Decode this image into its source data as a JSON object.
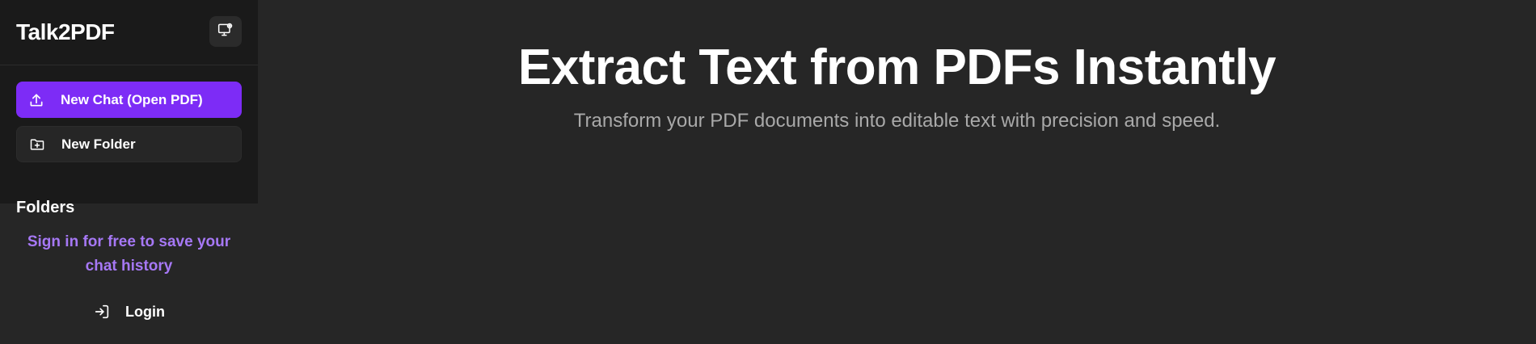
{
  "sidebar": {
    "brand": "Talk2PDF",
    "settings_icon": "monitor-settings-icon",
    "new_chat_label": "New Chat (Open PDF)",
    "new_chat_icon": "upload-icon",
    "new_folder_label": "New Folder",
    "new_folder_icon": "folder-plus-icon",
    "folders_heading": "Folders",
    "signin_prompt": "Sign in for free to save your chat history",
    "login_label": "Login",
    "login_icon": "login-icon"
  },
  "main": {
    "title": "Extract Text from PDFs Instantly",
    "subtitle": "Transform your PDF documents into editable text with precision and speed."
  },
  "colors": {
    "accent": "#7d2cf6",
    "link": "#a678f5",
    "background": "#262626",
    "sidebar_top": "#1a1a1a"
  }
}
